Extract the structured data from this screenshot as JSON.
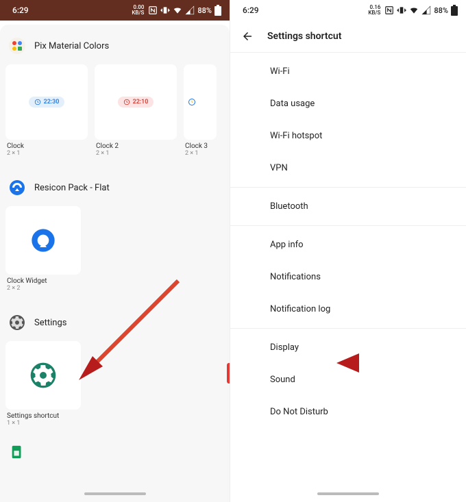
{
  "status": {
    "time": "6:29",
    "speed_left": "0.00",
    "speed_right": "0.16",
    "speed_unit": "KB/S",
    "battery": "88%"
  },
  "left": {
    "sections": {
      "pix": {
        "title": "Pix Material Colors"
      },
      "resicon": {
        "title": "Resicon Pack - Flat"
      },
      "settings": {
        "title": "Settings"
      }
    },
    "widgets": {
      "clock1": {
        "name": "Clock",
        "size": "2 × 1",
        "time": "22:30"
      },
      "clock2": {
        "name": "Clock 2",
        "size": "2 × 1",
        "time": "22:10"
      },
      "clock3": {
        "name": "Clock 3",
        "size": "2 × 1"
      },
      "clock_widget": {
        "name": "Clock Widget",
        "size": "2 × 2"
      },
      "settings_shortcut": {
        "name": "Settings shortcut",
        "size": "1 × 1"
      }
    }
  },
  "right": {
    "header": "Settings shortcut",
    "items": {
      "wifi": "Wi-Fi",
      "data": "Data usage",
      "hotspot": "Wi-Fi hotspot",
      "vpn": "VPN",
      "bt": "Bluetooth",
      "appinfo": "App info",
      "notif": "Notifications",
      "notiflog": "Notification log",
      "display": "Display",
      "sound": "Sound",
      "dnd": "Do Not Disturb"
    }
  }
}
